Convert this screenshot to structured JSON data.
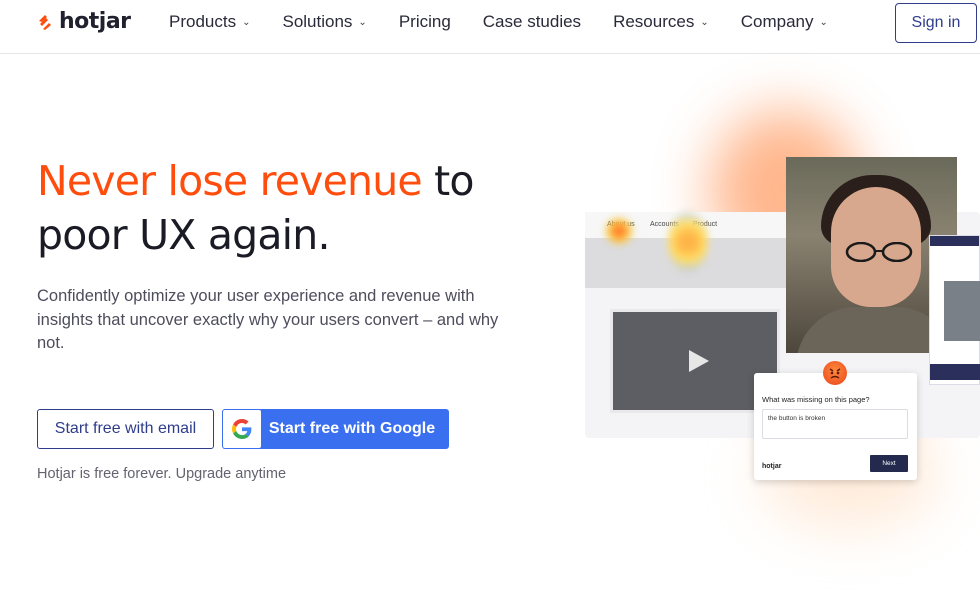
{
  "nav": {
    "brand": "hotjar",
    "items": [
      {
        "label": "Products",
        "has_dropdown": true
      },
      {
        "label": "Solutions",
        "has_dropdown": true
      },
      {
        "label": "Pricing",
        "has_dropdown": false
      },
      {
        "label": "Case studies",
        "has_dropdown": false
      },
      {
        "label": "Resources",
        "has_dropdown": true
      },
      {
        "label": "Company",
        "has_dropdown": true
      }
    ],
    "dropdown_glyph": "⌄",
    "sign_in": "Sign in"
  },
  "hero": {
    "headline_accent": "Never lose revenue",
    "headline_rest": " to poor UX again.",
    "subhead": "Confidently optimize your user experience and revenue with insights that uncover exactly why your users convert – and why not.",
    "cta_email": "Start free with email",
    "cta_google": "Start free with Google",
    "note": "Hotjar is free forever. Upgrade anytime"
  },
  "illustration": {
    "mini_nav": [
      "About us",
      "Accounts",
      "Product"
    ],
    "survey": {
      "question": "What was missing on this page?",
      "answer": "the button is broken",
      "brand": "hotjar",
      "next": "Next"
    },
    "emoji": "angry-face-icon"
  },
  "colors": {
    "accent_orange": "#ff4d0d",
    "primary_navy": "#2f3d8c",
    "google_blue": "#3a6ff0",
    "text_dark": "#1b1b26",
    "text_muted": "#4d4d5c"
  }
}
